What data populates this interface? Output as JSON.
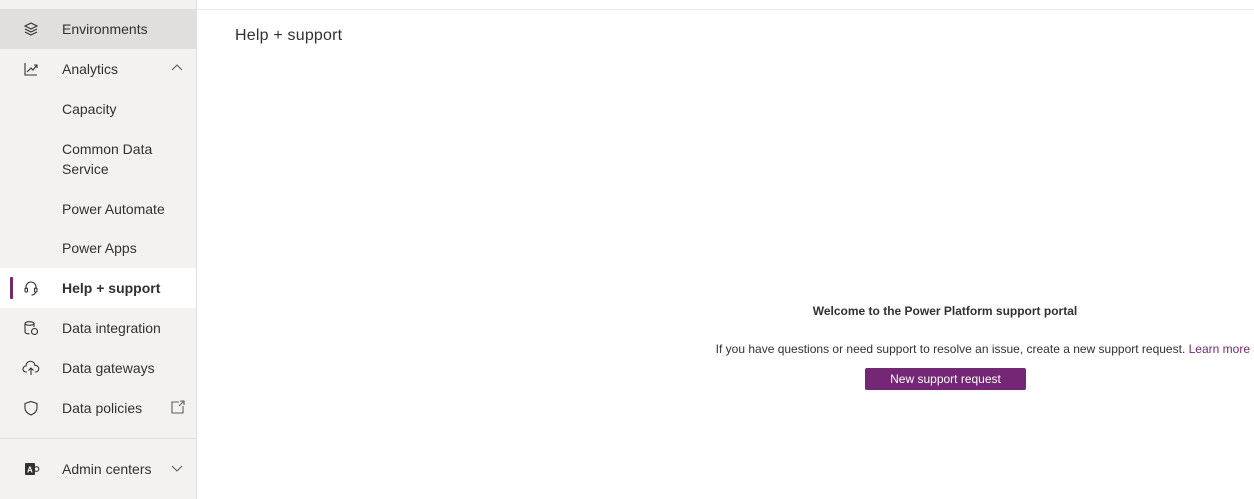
{
  "sidebar": {
    "items": [
      {
        "id": "environments",
        "label": "Environments",
        "icon": "layers-icon"
      },
      {
        "id": "analytics",
        "label": "Analytics",
        "icon": "chart-icon",
        "expanded": true
      },
      {
        "id": "capacity",
        "label": "Capacity"
      },
      {
        "id": "cds",
        "label": "Common Data Service"
      },
      {
        "id": "power-automate",
        "label": "Power Automate"
      },
      {
        "id": "power-apps",
        "label": "Power Apps"
      },
      {
        "id": "help-support",
        "label": "Help + support",
        "icon": "headset-icon",
        "selected": true
      },
      {
        "id": "data-integration",
        "label": "Data integration",
        "icon": "database-sync-icon"
      },
      {
        "id": "data-gateways",
        "label": "Data gateways",
        "icon": "cloud-gateway-icon"
      },
      {
        "id": "data-policies",
        "label": "Data policies",
        "icon": "shield-icon"
      },
      {
        "id": "admin-centers",
        "label": "Admin centers",
        "icon": "admin-icon"
      }
    ],
    "cds_lines": [
      "Common Data",
      "Service"
    ]
  },
  "main": {
    "title": "Help + support",
    "welcome": "Welcome to the Power Platform support portal",
    "description": "If you have questions or need support to resolve an issue, create a new support request.",
    "learn_more": "Learn more",
    "button_label": "New support request"
  },
  "colors": {
    "accent": "#742774",
    "sidebar_bg": "#f3f2f1",
    "hover_bg": "#e1dfdd"
  }
}
